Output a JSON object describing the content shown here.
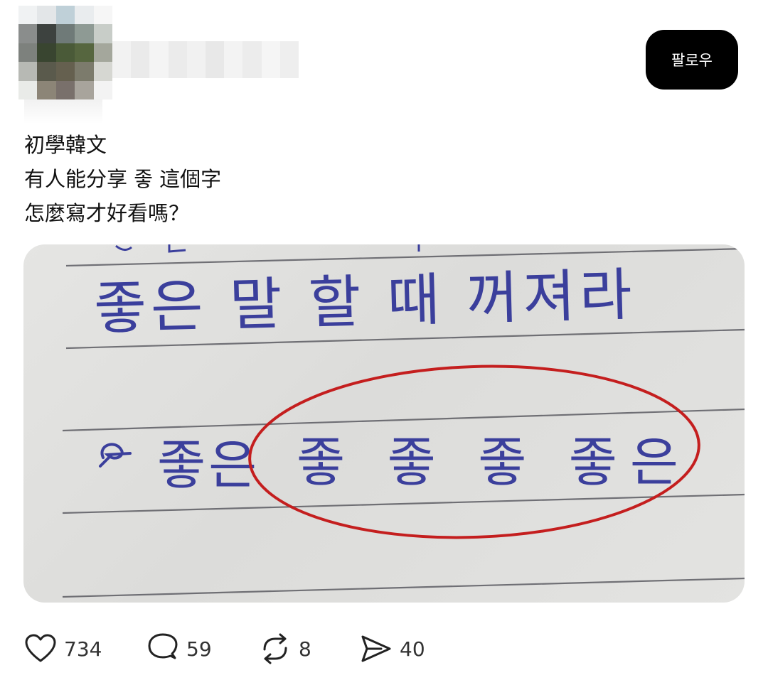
{
  "header": {
    "follow_label": "팔로우"
  },
  "post": {
    "lines": [
      "初學韓文",
      "有人能分享 좋 這個字",
      "怎麼寫才好看嗎？"
    ]
  },
  "image": {
    "handwriting_line_1": "좋은 말 할 때 꺼져라",
    "handwriting_line_2_label": "좋은",
    "handwriting_circled": "좋 좋 좋 좋은",
    "ink_color": "#3b3f9c",
    "circle_color": "#c41e1e",
    "paper_color": "#e3e3e1",
    "rule_color": "#4a4a52"
  },
  "actions": {
    "like": {
      "icon": "heart-icon",
      "count": "734"
    },
    "comment": {
      "icon": "comment-icon",
      "count": "59"
    },
    "repost": {
      "icon": "repost-icon",
      "count": "8"
    },
    "share": {
      "icon": "share-icon",
      "count": "40"
    }
  },
  "colors": {
    "follow_bg": "#000000",
    "follow_text": "#ffffff",
    "count_text": "#333333"
  }
}
